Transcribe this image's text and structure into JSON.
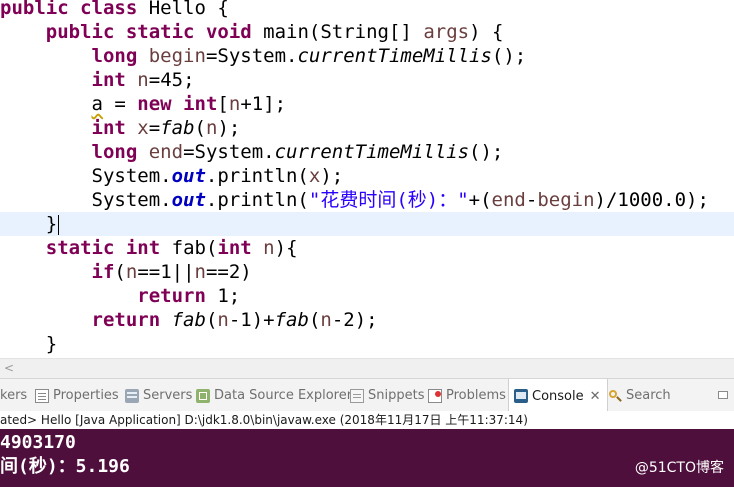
{
  "editor": {
    "line1": {
      "kw1": "public",
      "kw2": "class",
      "rest": " Hello {"
    },
    "line2": {
      "kw1": "public",
      "kw2": "static",
      "kw3": "void",
      "mid": " main(String[] ",
      "param": "args",
      "end": ") {"
    },
    "line3": {
      "kw": "long",
      "var": "begin",
      "eq": "=System.",
      "method": "currentTimeMillis",
      "end": "();"
    },
    "line4": {
      "kw": "int",
      "var": "n",
      "end": "=45;"
    },
    "line5": {
      "var": "a",
      "mid": " = ",
      "kw1": "new",
      "kw2": "int",
      "open": "[",
      "var2": "n",
      "end": "+1];"
    },
    "line6": {
      "kw": "int",
      "var": "x",
      "eq": "=",
      "method": "fab",
      "open": "(",
      "var2": "n",
      "end": ");"
    },
    "line7": {
      "kw": "long",
      "var": "end",
      "eq": "=System.",
      "method": "currentTimeMillis",
      "end": "();"
    },
    "line8": {
      "obj": "System.",
      "field": "out",
      "mid": ".println(",
      "var": "x",
      "end": ");"
    },
    "line9": {
      "obj": "System.",
      "field": "out",
      "mid": ".println(",
      "str": "\"花费时间(秒)：\"",
      "plus": "+(",
      "var1": "end",
      "minus": "-",
      "var2": "begin",
      "end": ")/1000.0);"
    },
    "line10": {
      "text": "}"
    },
    "line11": {
      "kw1": "static",
      "kw2": "int",
      "mid": " fab(",
      "kw3": "int",
      "sp": " ",
      "var": "n",
      "end": "){"
    },
    "line12": {
      "kw": "if",
      "open": "(",
      "var1": "n",
      "op1": "==1||",
      "var2": "n",
      "end": "==2)"
    },
    "line13": {
      "kw": "return",
      "end": " 1;"
    },
    "line14": {
      "kw": "return",
      "sp": " ",
      "m1": "fab",
      "o1": "(",
      "v1": "n",
      "e1": "-1)+",
      "m2": "fab",
      "o2": "(",
      "v2": "n",
      "e2": "-2);"
    },
    "line15": {
      "text": "}"
    }
  },
  "scrollbar": {
    "left_arrow": "<"
  },
  "tabs": [
    {
      "label": "kers"
    },
    {
      "label": "Properties",
      "icon": "properties-icon"
    },
    {
      "label": "Servers",
      "icon": "servers-icon"
    },
    {
      "label": "Data Source Explorer",
      "icon": "data-source-explorer-icon"
    },
    {
      "label": "Snippets",
      "icon": "snippets-icon"
    },
    {
      "label": "Problems",
      "icon": "problems-icon"
    },
    {
      "label": "Console",
      "icon": "console-icon",
      "close": "✕"
    },
    {
      "label": "Search",
      "icon": "search-icon"
    }
  ],
  "console": {
    "status": "ated> Hello [Java Application] D:\\jdk1.8.0\\bin\\javaw.exe (2018年11月17日 上午11:37:14)",
    "output_line1": "4903170",
    "output_line2": "间(秒)：5.196",
    "watermark": "@51CTO博客"
  },
  "colors": {
    "keyword": "#7f0055",
    "field": "#0000c0",
    "string": "#2a00ff",
    "console_bg": "#4e0f3c",
    "current_line": "#e8f2fe"
  }
}
